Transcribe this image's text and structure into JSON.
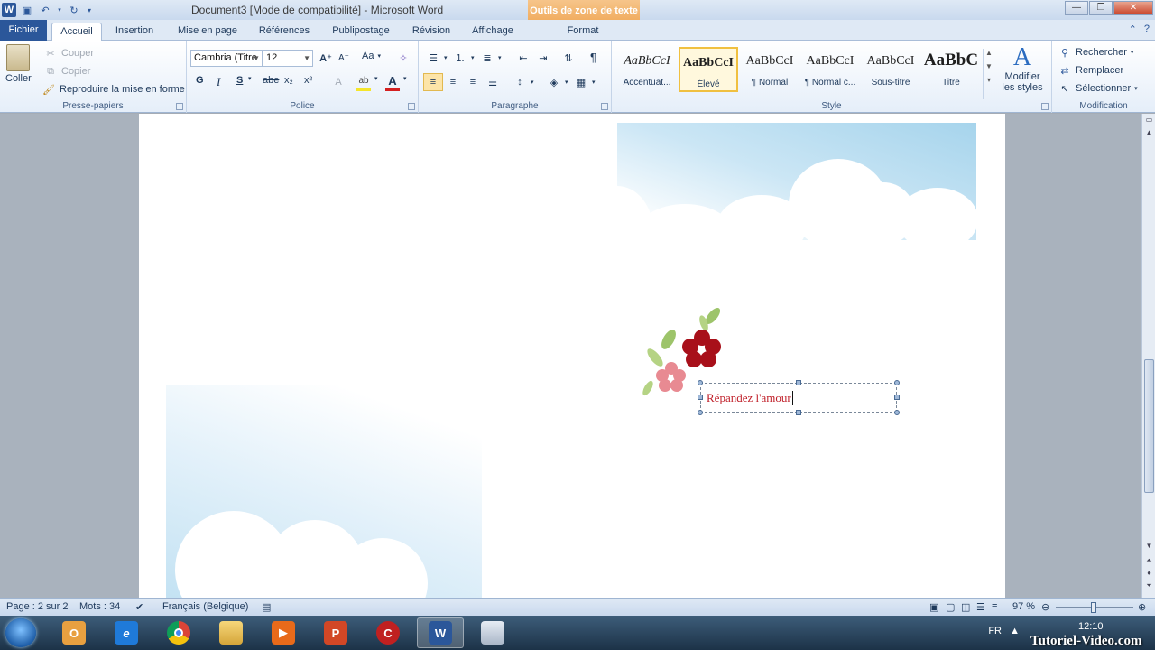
{
  "window": {
    "title": "Document3 [Mode de compatibilité]  -  Microsoft Word",
    "context_tab_header": "Outils de zone de texte"
  },
  "tabs": {
    "fichier": "Fichier",
    "accueil": "Accueil",
    "insertion": "Insertion",
    "mise_en_page": "Mise en page",
    "references": "Références",
    "publipostage": "Publipostage",
    "revision": "Révision",
    "affichage": "Affichage",
    "format": "Format"
  },
  "clipboard": {
    "paste": "Coller",
    "cut": "Couper",
    "copy": "Copier",
    "format_painter": "Reproduire la mise en forme",
    "label": "Presse-papiers"
  },
  "font": {
    "name": "Cambria (Titre",
    "size": "12",
    "bold": "G",
    "italic": "I",
    "underline": "S",
    "strike": "abe",
    "subscript": "x₂",
    "superscript": "x²",
    "case": "Aa",
    "label": "Police"
  },
  "paragraph": {
    "label": "Paragraphe",
    "pilcrow": "¶"
  },
  "styles": {
    "label": "Style",
    "items": [
      {
        "sample": "AaBbCcI",
        "name": "Accentuat..."
      },
      {
        "sample": "AaBbCcI",
        "name": "Élevé"
      },
      {
        "sample": "AaBbCcI",
        "name": "¶ Normal"
      },
      {
        "sample": "AaBbCcI",
        "name": "¶ Normal c..."
      },
      {
        "sample": "AaBbCcI",
        "name": "Sous-titre"
      },
      {
        "sample": "AaBbC",
        "name": "Titre"
      }
    ],
    "modify_line1": "Modifier",
    "modify_line2": "les styles"
  },
  "editing": {
    "label": "Modification",
    "find": "Rechercher",
    "replace": "Remplacer",
    "select": "Sélectionner"
  },
  "document": {
    "textbox_text": "Répandez l'amour"
  },
  "status": {
    "page": "Page : 2 sur 2",
    "words": "Mots : 34",
    "language": "Français (Belgique)",
    "zoom": "97 %"
  },
  "taskbar": {
    "lang": "FR",
    "time": "12:10",
    "watermark": "Tutoriel-Video.com"
  },
  "colors": {
    "accent": "#2b579a",
    "context": "#f0a95a",
    "text_red": "#c0202a",
    "highlight": "#f5e52a",
    "font_color": "#d42020"
  }
}
